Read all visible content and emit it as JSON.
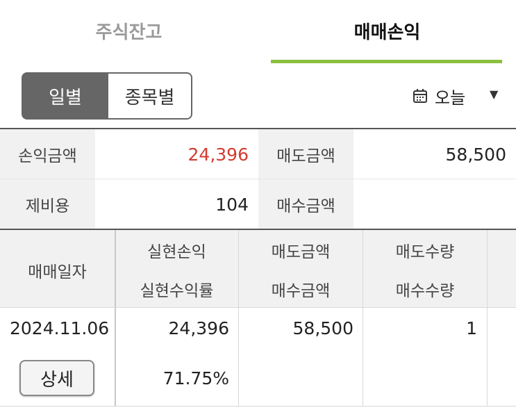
{
  "colors": {
    "accent": "#8cbf3f",
    "red": "#d23b2f",
    "segment_active_bg": "#666666"
  },
  "tabs": {
    "holdings": "주식잔고",
    "trade_pnl": "매매손익",
    "active": "trade_pnl"
  },
  "view_toggle": {
    "daily": "일별",
    "by_stock": "종목별",
    "selected": "daily"
  },
  "period_select": {
    "icon": "calendar-icon",
    "value": "오늘"
  },
  "summary": {
    "pnl_amount_label": "손익금액",
    "pnl_amount": "24,396",
    "sell_amount_label": "매도금액",
    "sell_amount": "58,500",
    "fees_label": "제비용",
    "fees": "104",
    "buy_amount_label": "매수금액",
    "buy_amount": ""
  },
  "table": {
    "headers": {
      "trade_date": "매매일자",
      "realized_pnl": "실현손익",
      "realized_rate": "실현수익률",
      "sell_amount": "매도금액",
      "buy_amount": "매수금액",
      "sell_qty": "매도수량",
      "buy_qty": "매수수량"
    },
    "rows": [
      {
        "trade_date": "2024.11.06",
        "detail_button": "상세",
        "realized_pnl": "24,396",
        "realized_rate": "71.75%",
        "sell_amount": "58,500",
        "buy_amount": "",
        "sell_qty": "1",
        "buy_qty": ""
      }
    ]
  }
}
